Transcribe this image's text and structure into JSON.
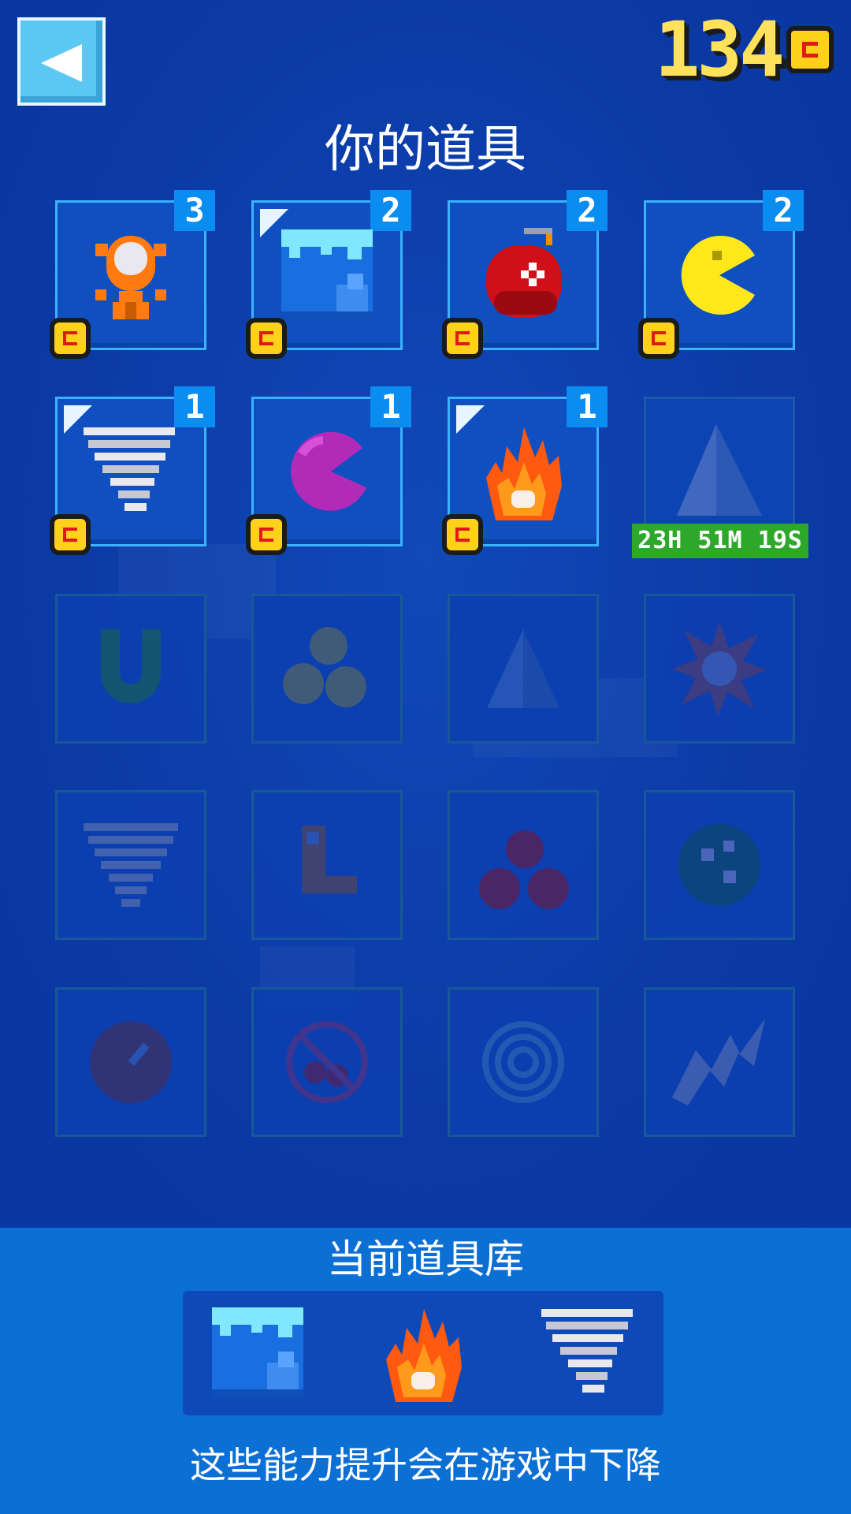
{
  "header": {
    "back_label": "back",
    "coins": "134"
  },
  "title": "你的道具",
  "powerups": [
    {
      "name": "trophy",
      "count": "3",
      "owned": true,
      "flag": false
    },
    {
      "name": "ice-block",
      "count": "2",
      "owned": true,
      "flag": true
    },
    {
      "name": "bomb",
      "count": "2",
      "owned": true,
      "flag": false
    },
    {
      "name": "pacman",
      "count": "2",
      "owned": true,
      "flag": false
    },
    {
      "name": "tornado",
      "count": "1",
      "owned": true,
      "flag": true
    },
    {
      "name": "purple-pacman",
      "count": "1",
      "owned": true,
      "flag": false
    },
    {
      "name": "fire",
      "count": "1",
      "owned": true,
      "flag": true
    }
  ],
  "timer": "23H 51M 19S",
  "locked": [
    "pyramid",
    "magnet",
    "triple-pacman",
    "pyramid-small",
    "explosion",
    "tornado-gray",
    "boot",
    "cherry-bombs",
    "spotted-orb",
    "ball",
    "no-cherry",
    "target",
    "lightning"
  ],
  "loadout": {
    "title": "当前道具库",
    "items": [
      "ice-block",
      "fire",
      "tornado"
    ]
  },
  "note": "这些能力提升会在游戏中下降"
}
